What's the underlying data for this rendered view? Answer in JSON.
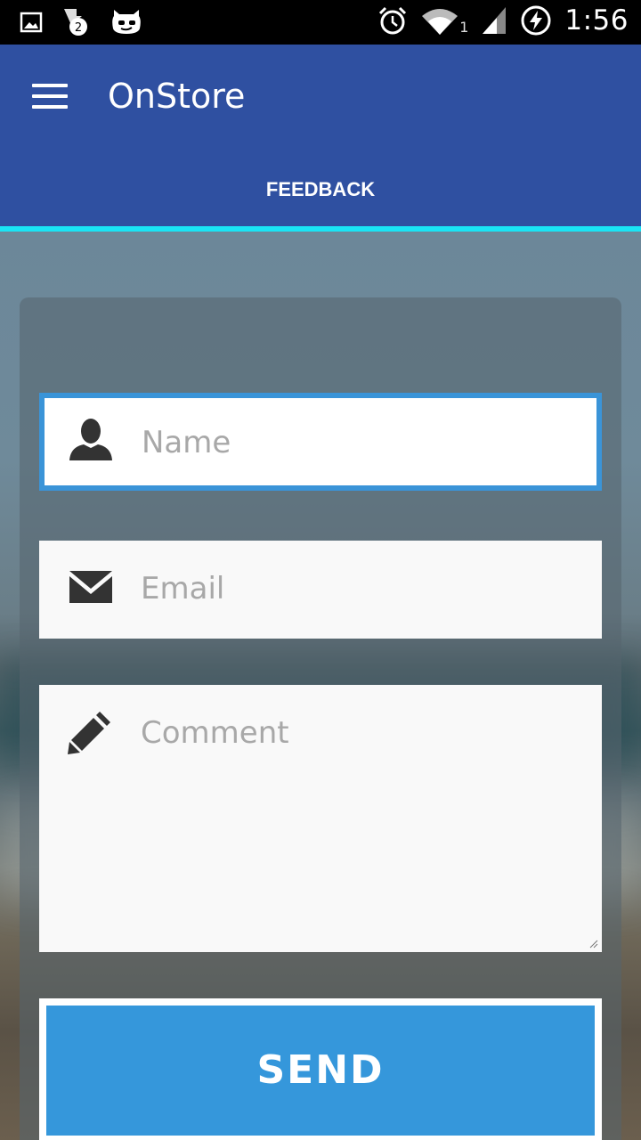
{
  "status_bar": {
    "time": "1:56",
    "signal_sim": "1",
    "notification_badge": "2",
    "icons": [
      "image-icon",
      "download-badge-icon",
      "cyanogen-icon",
      "alarm-icon",
      "wifi-icon",
      "signal-icon",
      "battery-charging-icon"
    ]
  },
  "app_bar": {
    "title": "OnStore",
    "menu_icon": "hamburger-menu-icon",
    "color": "#2f50a1"
  },
  "tabs": [
    {
      "label": "FEEDBACK",
      "selected": true,
      "indicator_color": "#1ae4f5"
    }
  ],
  "form": {
    "name": {
      "placeholder": "Name",
      "value": "",
      "icon": "person-icon",
      "focused": true
    },
    "email": {
      "placeholder": "Email",
      "value": "",
      "icon": "envelope-icon"
    },
    "comment": {
      "placeholder": "Comment",
      "value": "",
      "icon": "pencil-icon"
    },
    "focus_color": "#3a94d8"
  },
  "send_button": {
    "label": "SEND",
    "color": "#3597db"
  }
}
